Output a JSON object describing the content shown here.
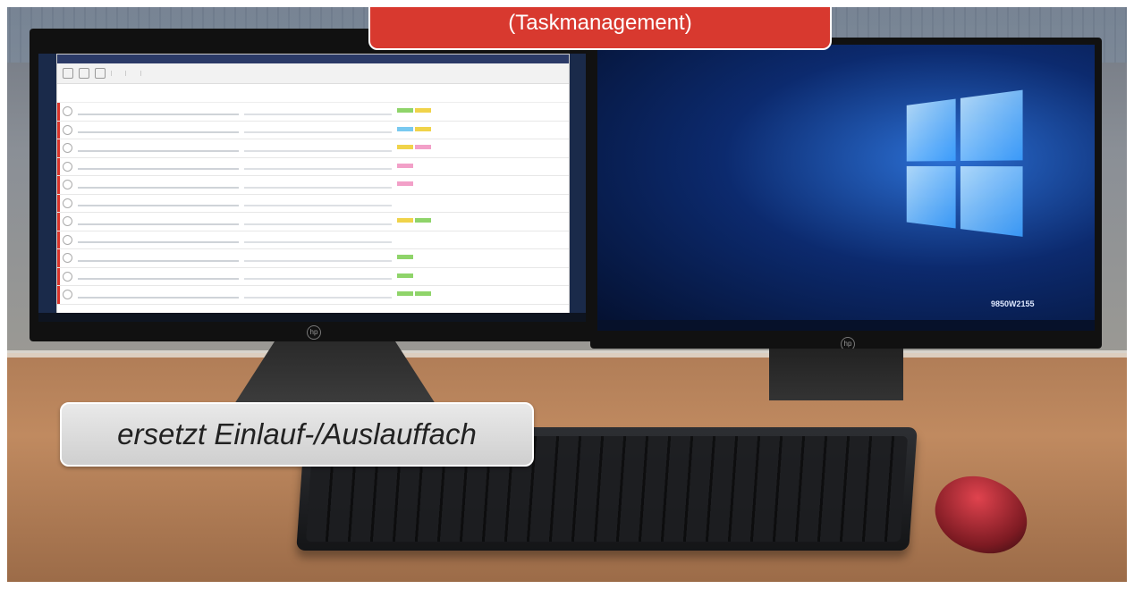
{
  "banner": {
    "subtitle": "(Taskmanagement)"
  },
  "callout": {
    "text": "ersetzt Einlauf-/Auslauffach"
  },
  "monitor_right": {
    "lock_text": "9850W2155"
  },
  "task_rows": [
    {
      "tags": [
        "g",
        "y"
      ]
    },
    {
      "tags": [
        "b",
        "y"
      ]
    },
    {
      "tags": [
        "y",
        "p"
      ]
    },
    {
      "tags": [
        "p"
      ]
    },
    {
      "tags": [
        "p"
      ]
    },
    {
      "tags": []
    },
    {
      "tags": [
        "y",
        "g"
      ]
    },
    {
      "tags": []
    },
    {
      "tags": [
        "g"
      ]
    },
    {
      "tags": [
        "g"
      ]
    },
    {
      "tags": [
        "g",
        "g"
      ]
    }
  ]
}
